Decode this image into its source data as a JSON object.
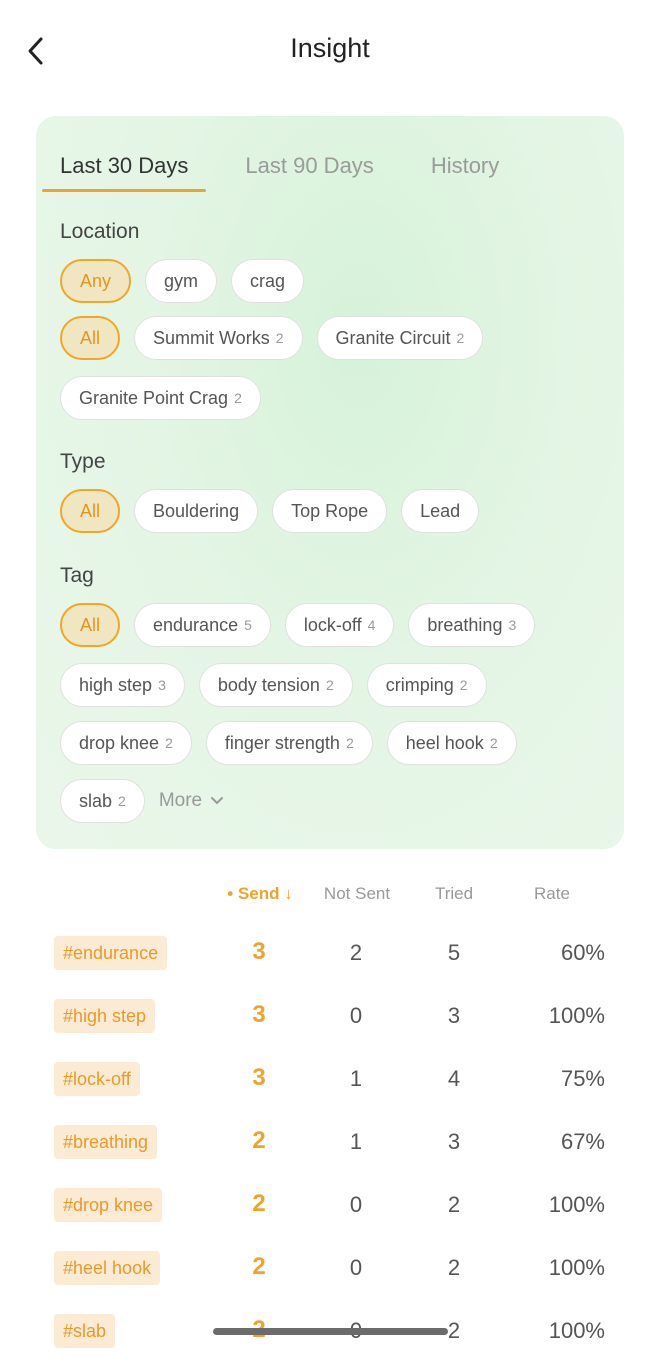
{
  "header": {
    "title": "Insight",
    "back_icon": "chevron-left-icon"
  },
  "tabs": [
    {
      "label": "Last 30 Days",
      "active": true
    },
    {
      "label": "Last 90 Days",
      "active": false
    },
    {
      "label": "History",
      "active": false
    }
  ],
  "filters": {
    "location": {
      "title": "Location",
      "kind": [
        {
          "label": "Any",
          "selected": true
        },
        {
          "label": "gym",
          "selected": false
        },
        {
          "label": "crag",
          "selected": false
        }
      ],
      "places_row1": [
        {
          "label": "All",
          "count": "",
          "selected": true
        },
        {
          "label": "Summit Works",
          "count": "2",
          "selected": false
        },
        {
          "label": "Granite Circuit",
          "count": "2",
          "selected": false
        }
      ],
      "places_row2": [
        {
          "label": "Granite Point Crag",
          "count": "2",
          "selected": false
        }
      ]
    },
    "type": {
      "title": "Type",
      "options": [
        {
          "label": "All",
          "selected": true
        },
        {
          "label": "Bouldering",
          "selected": false
        },
        {
          "label": "Top Rope",
          "selected": false
        },
        {
          "label": "Lead",
          "selected": false
        }
      ]
    },
    "tag": {
      "title": "Tag",
      "row1": [
        {
          "label": "All",
          "count": "",
          "selected": true
        },
        {
          "label": "endurance",
          "count": "5",
          "selected": false
        },
        {
          "label": "lock-off",
          "count": "4",
          "selected": false
        },
        {
          "label": "breathing",
          "count": "3",
          "selected": false
        }
      ],
      "row2": [
        {
          "label": "high step",
          "count": "3"
        },
        {
          "label": "body tension",
          "count": "2"
        },
        {
          "label": "crimping",
          "count": "2"
        }
      ],
      "row3": [
        {
          "label": "drop knee",
          "count": "2"
        },
        {
          "label": "finger strength",
          "count": "2"
        },
        {
          "label": "heel hook",
          "count": "2"
        }
      ],
      "row4": [
        {
          "label": "slab",
          "count": "2"
        }
      ],
      "more_label": "More",
      "more_icon": "chevron-down-icon"
    }
  },
  "table": {
    "headers": {
      "send": "• Send ↓",
      "not_sent": "Not Sent",
      "tried": "Tried",
      "rate": "Rate"
    },
    "rows": [
      {
        "tag": "#endurance",
        "send": "3",
        "not_sent": "2",
        "tried": "5",
        "rate": "60%"
      },
      {
        "tag": "#high step",
        "send": "3",
        "not_sent": "0",
        "tried": "3",
        "rate": "100%"
      },
      {
        "tag": "#lock-off",
        "send": "3",
        "not_sent": "1",
        "tried": "4",
        "rate": "75%"
      },
      {
        "tag": "#breathing",
        "send": "2",
        "not_sent": "1",
        "tried": "3",
        "rate": "67%"
      },
      {
        "tag": "#drop knee",
        "send": "2",
        "not_sent": "0",
        "tried": "2",
        "rate": "100%"
      },
      {
        "tag": "#heel hook",
        "send": "2",
        "not_sent": "0",
        "tried": "2",
        "rate": "100%"
      },
      {
        "tag": "#slab",
        "send": "2",
        "not_sent": "0",
        "tried": "2",
        "rate": "100%"
      }
    ]
  },
  "colors": {
    "accent": "#f0a32a",
    "tag_bg": "#fcebd4",
    "card_bg": "#e3f5e4"
  }
}
